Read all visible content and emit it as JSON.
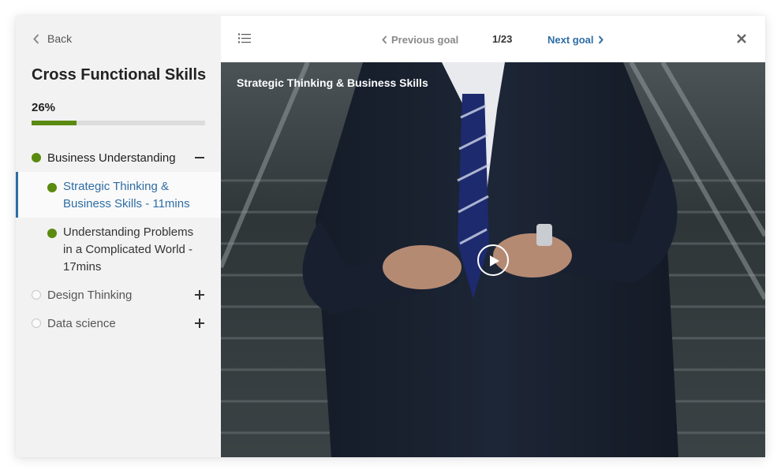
{
  "sidebar": {
    "back_label": "Back",
    "course_title": "Cross Functional Skills",
    "progress_text": "26%",
    "progress_value": 0.26,
    "sections": [
      {
        "label": "Business Understanding",
        "state": "started",
        "expanded": true,
        "lessons": [
          {
            "label": "Strategic Thinking & Business Skills - 11mins",
            "active": true
          },
          {
            "label": "Understanding Problems in a Complicated World - 17mins",
            "active": false
          }
        ]
      },
      {
        "label": "Design Thinking",
        "state": "not-started",
        "expanded": false
      },
      {
        "label": "Data science",
        "state": "not-started",
        "expanded": false
      }
    ]
  },
  "topbar": {
    "previous_label": "Previous goal",
    "counter": "1/23",
    "next_label": "Next goal"
  },
  "video": {
    "title": "Strategic Thinking & Business Skills"
  },
  "colors": {
    "accent_blue": "#2e6da4",
    "progress_green": "#5a8a0f",
    "sidebar_bg": "#f2f2f2"
  },
  "icons": [
    "chevron-left-icon",
    "list-icon",
    "chevron-right-icon",
    "close-icon",
    "minus-icon",
    "plus-icon",
    "play-icon"
  ]
}
